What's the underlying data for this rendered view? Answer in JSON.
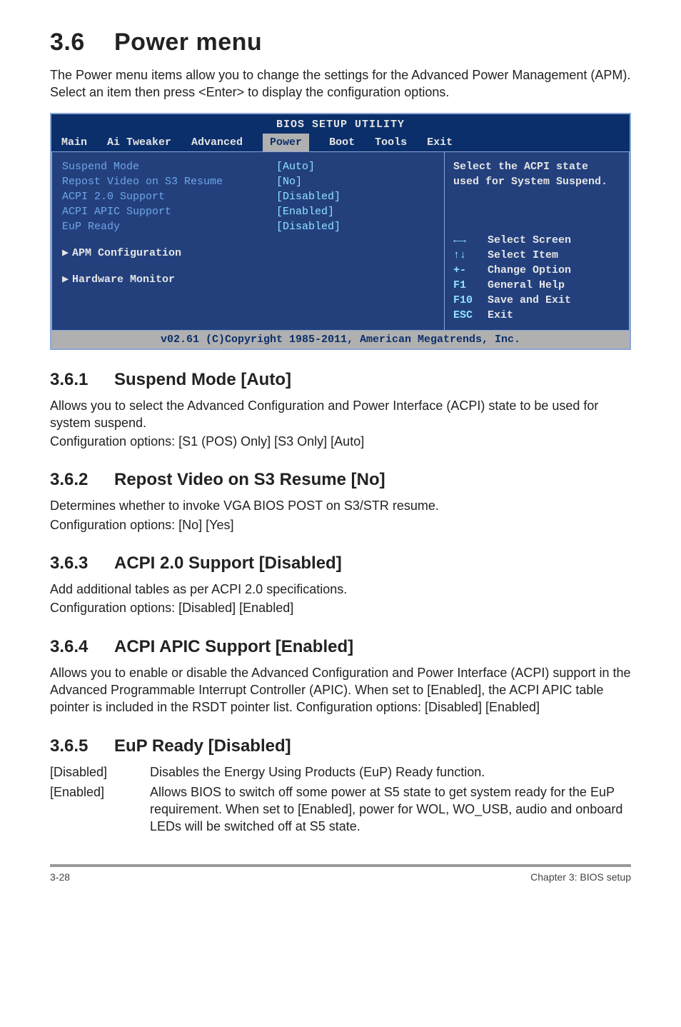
{
  "section": {
    "num": "3.6",
    "title": "Power menu",
    "intro": "The Power menu items allow you to change the settings for the Advanced Power Management (APM). Select an item then press <Enter> to display the configuration options."
  },
  "bios": {
    "title": "BIOS SETUP UTILITY",
    "tabs": {
      "main": "Main",
      "aitweaker": "Ai Tweaker",
      "advanced": "Advanced",
      "power": "Power",
      "boot": "Boot",
      "tools": "Tools",
      "exit": "Exit"
    },
    "items": [
      {
        "k": "Suspend Mode",
        "v": "[Auto]"
      },
      {
        "k": "Repost Video on S3 Resume",
        "v": "[No]"
      },
      {
        "k": "ACPI 2.0 Support",
        "v": "[Disabled]"
      },
      {
        "k": "ACPI APIC Support",
        "v": "[Enabled]"
      },
      {
        "k": "EuP Ready",
        "v": "[Disabled]"
      }
    ],
    "submenus": [
      "APM Configuration",
      "Hardware Monitor"
    ],
    "help": "Select the ACPI state used for System Suspend.",
    "keys": [
      {
        "sym": "←→",
        "label": "Select Screen"
      },
      {
        "sym": "↑↓",
        "label": "Select Item"
      },
      {
        "sym": "+-",
        "label": "Change Option"
      },
      {
        "sym": "F1",
        "label": "General Help"
      },
      {
        "sym": "F10",
        "label": "Save and Exit"
      },
      {
        "sym": "ESC",
        "label": "Exit"
      }
    ],
    "copyright": "v02.61 (C)Copyright 1985-2011, American Megatrends, Inc."
  },
  "subs": {
    "s361": {
      "num": "3.6.1",
      "title": "Suspend Mode [Auto]",
      "p1": "Allows you to select the Advanced Configuration and Power Interface (ACPI) state to be used for system suspend.",
      "p2": "Configuration options: [S1 (POS) Only] [S3 Only] [Auto]"
    },
    "s362": {
      "num": "3.6.2",
      "title": "Repost Video on S3 Resume [No]",
      "p1": "Determines whether to invoke VGA BIOS POST on S3/STR resume.",
      "p2": "Configuration options: [No] [Yes]"
    },
    "s363": {
      "num": "3.6.3",
      "title": "ACPI 2.0 Support [Disabled]",
      "p1": "Add additional tables as per ACPI 2.0 specifications.",
      "p2": "Configuration options: [Disabled] [Enabled]"
    },
    "s364": {
      "num": "3.6.4",
      "title": "ACPI APIC Support [Enabled]",
      "p1": "Allows you to enable or disable the Advanced Configuration and Power Interface (ACPI) support in the Advanced Programmable Interrupt Controller (APIC). When set to [Enabled], the ACPI APIC table pointer is included in the RSDT pointer list. Configuration options: [Disabled] [Enabled]"
    },
    "s365": {
      "num": "3.6.5",
      "title": "EuP Ready [Disabled]",
      "defs": [
        {
          "lbl": "[Disabled]",
          "val": "Disables the Energy Using Products (EuP) Ready function."
        },
        {
          "lbl": "[Enabled]",
          "val": "Allows BIOS to switch off some power at S5 state to get system ready for the EuP requirement. When set to [Enabled], power for WOL, WO_USB, audio and onboard LEDs will be switched off at S5 state."
        }
      ]
    }
  },
  "footer": {
    "page": "3-28",
    "chapter": "Chapter 3: BIOS setup"
  }
}
